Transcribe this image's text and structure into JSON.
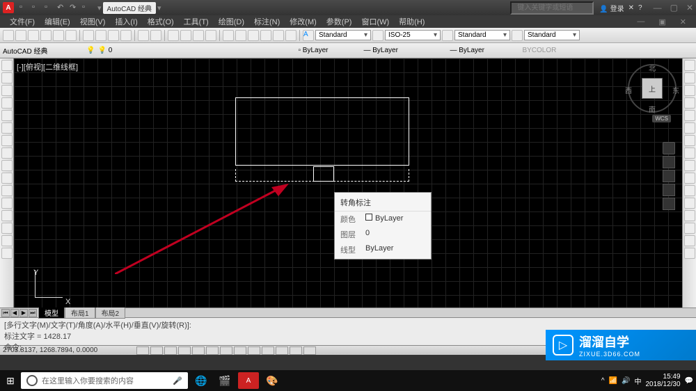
{
  "titlebar": {
    "logo": "A",
    "workspace": "AutoCAD 经典",
    "search_placeholder": "键入关键字或短语",
    "login": "登录"
  },
  "menu": [
    "文件(F)",
    "编辑(E)",
    "视图(V)",
    "插入(I)",
    "格式(O)",
    "工具(T)",
    "绘图(D)",
    "标注(N)",
    "修改(M)",
    "参数(P)",
    "窗口(W)",
    "帮助(H)"
  ],
  "toolbar1": {
    "workspace_dd": "AutoCAD 经典",
    "layer_dd": "0"
  },
  "styles": {
    "text": "Standard",
    "dim": "ISO-25",
    "table": "Standard",
    "mlead": "Standard"
  },
  "props": {
    "color": "ByLayer",
    "linetype": "ByLayer",
    "lineweight": "ByLayer",
    "bycolor": "BYCOLOR"
  },
  "viewport": "[-][俯视][二维线框]",
  "viewcube": {
    "top": "上",
    "n": "北",
    "e": "东",
    "w": "西",
    "s": "南",
    "wcs": "WCS"
  },
  "ucs": {
    "x": "X",
    "y": "Y"
  },
  "tooltip": {
    "title": "转角标注",
    "rows": [
      {
        "label": "颜色",
        "value": "ByLayer",
        "swatch": true
      },
      {
        "label": "图层",
        "value": "0"
      },
      {
        "label": "线型",
        "value": "ByLayer"
      }
    ]
  },
  "tabs": {
    "model": "模型",
    "layout1": "布局1",
    "layout2": "布局2"
  },
  "cmdline": {
    "line1": "[多行文字(M)/文字(T)/角度(A)/水平(H)/垂直(V)/旋转(R)]:",
    "line2": "标注文字 = 1428.17",
    "line3": "命令:"
  },
  "statusbar": {
    "coords": "2703.8137, 1268.7894, 0.0000"
  },
  "watermark": {
    "title": "溜溜自学",
    "sub": "ZIXUE.3D66.COM"
  },
  "taskbar": {
    "search": "在这里输入你要搜索的内容",
    "time": "15:49",
    "date": "2018/12/30"
  }
}
